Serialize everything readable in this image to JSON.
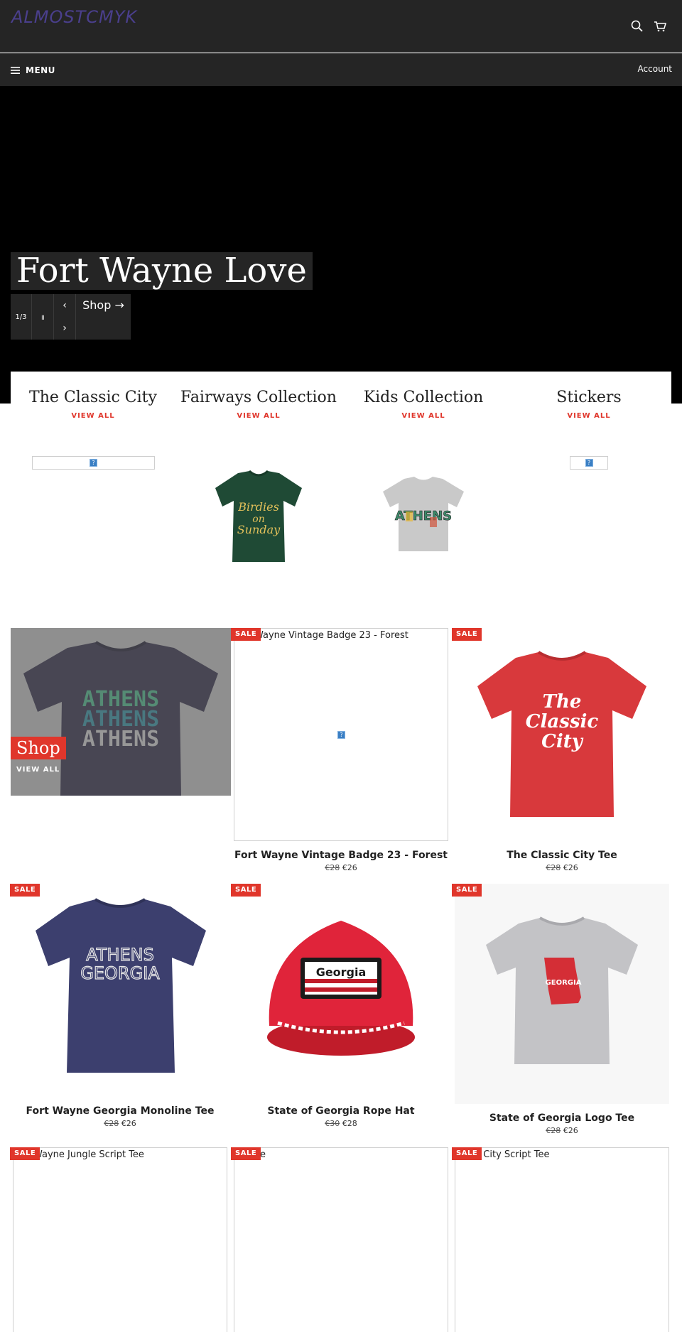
{
  "header": {
    "logo": "ALMOSTCMYK",
    "menu_label": "MENU",
    "account_label": "Account"
  },
  "hero": {
    "title": "Fort Wayne Love",
    "slide_counter": "1/3",
    "pause_glyph": "॥",
    "prev_glyph": "‹",
    "next_glyph": "›",
    "shop_label": "Shop →"
  },
  "collections": [
    {
      "title": "The Classic City",
      "link": "VIEW ALL"
    },
    {
      "title": "Fairways Collection",
      "link": "VIEW ALL",
      "shirt_text": "Birdies on Sunday"
    },
    {
      "title": "Kids Collection",
      "link": "VIEW ALL",
      "shirt_text": "ATHENS"
    },
    {
      "title": "Stickers",
      "link": "VIEW ALL"
    }
  ],
  "promo": {
    "shop_label": "Shop",
    "view_all": "VIEW ALL",
    "shirt_text": [
      "ATHENS",
      "ATHENS",
      "ATHENS"
    ]
  },
  "products": [
    {
      "badge": "SALE",
      "alt": "Fort Wayne Vintage Badge 23 - Forest",
      "alt_visible": "Wayne Vintage Badge 23 - Forest",
      "name": "Fort Wayne Vintage Badge 23 - Forest",
      "old_price": "€28",
      "price": "€26"
    },
    {
      "badge": "SALE",
      "name": "The Classic City Tee",
      "old_price": "€28",
      "price": "€26",
      "shirt_text": [
        "The",
        "Classic",
        "City"
      ]
    },
    {
      "badge": "SALE",
      "name": "Fort Wayne Georgia Monoline Tee",
      "old_price": "€28",
      "price": "€26",
      "shirt_text": [
        "ATHENS",
        "GEORGIA"
      ]
    },
    {
      "badge": "SALE",
      "name": "State of Georgia Rope Hat",
      "old_price": "€30",
      "price": "€28",
      "patch_text": "Georgia"
    },
    {
      "badge": "SALE",
      "name": "State of Georgia Logo Tee",
      "old_price": "€28",
      "price": "€26",
      "shirt_text": "GEORGIA"
    },
    {
      "badge": "SALE",
      "alt_visible": "Wayne Jungle Script Tee"
    },
    {
      "badge": "SALE",
      "alt_visible": "ee"
    },
    {
      "badge": "SALE",
      "alt_visible": "c City Script Tee"
    }
  ],
  "colors": {
    "header_bg": "#252525",
    "accent": "#e0362b",
    "logo": "#4a3f8c"
  }
}
